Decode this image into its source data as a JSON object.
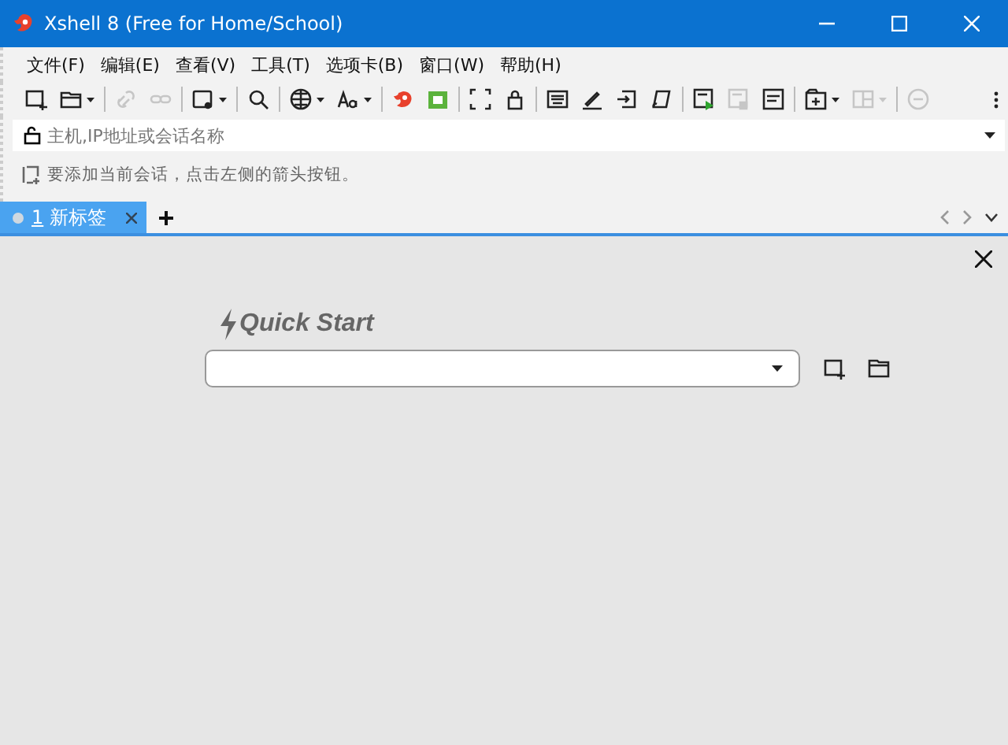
{
  "window": {
    "title": "Xshell 8 (Free for Home/School)"
  },
  "menu": [
    "文件(F)",
    "编辑(E)",
    "查看(V)",
    "工具(T)",
    "选项卡(B)",
    "窗口(W)",
    "帮助(H)"
  ],
  "toolbar": [
    {
      "kind": "button",
      "disabled": false,
      "dropdown": false
    },
    {
      "kind": "button",
      "disabled": false,
      "dropdown": true
    },
    {
      "kind": "separator"
    },
    {
      "kind": "button",
      "disabled": true,
      "dropdown": false
    },
    {
      "kind": "button",
      "disabled": true,
      "dropdown": false
    },
    {
      "kind": "separator"
    },
    {
      "kind": "button",
      "disabled": false,
      "dropdown": true
    },
    {
      "kind": "separator"
    },
    {
      "kind": "button",
      "disabled": false,
      "dropdown": false
    },
    {
      "kind": "separator"
    },
    {
      "kind": "button",
      "disabled": false,
      "dropdown": true
    },
    {
      "kind": "button",
      "disabled": false,
      "dropdown": true
    },
    {
      "kind": "separator"
    },
    {
      "kind": "button",
      "disabled": false,
      "dropdown": false
    },
    {
      "kind": "button",
      "disabled": false,
      "dropdown": false
    },
    {
      "kind": "separator"
    },
    {
      "kind": "button",
      "disabled": false,
      "dropdown": false
    },
    {
      "kind": "button",
      "disabled": false,
      "dropdown": false
    },
    {
      "kind": "separator"
    },
    {
      "kind": "button",
      "disabled": false,
      "dropdown": false
    },
    {
      "kind": "button",
      "disabled": false,
      "dropdown": false
    },
    {
      "kind": "button",
      "disabled": false,
      "dropdown": false
    },
    {
      "kind": "button",
      "disabled": false,
      "dropdown": false
    },
    {
      "kind": "separator"
    },
    {
      "kind": "button",
      "disabled": false,
      "dropdown": false
    },
    {
      "kind": "button",
      "disabled": true,
      "dropdown": false
    },
    {
      "kind": "button",
      "disabled": false,
      "dropdown": false
    },
    {
      "kind": "separator"
    },
    {
      "kind": "button",
      "disabled": false,
      "dropdown": true
    },
    {
      "kind": "button",
      "disabled": true,
      "dropdown": true
    },
    {
      "kind": "separator"
    },
    {
      "kind": "button",
      "disabled": true,
      "dropdown": false
    }
  ],
  "address_bar": {
    "placeholder": "主机,IP地址或会话名称"
  },
  "hint": "要添加当前会话，点击左侧的箭头按钮。",
  "tabs": [
    {
      "number": "1",
      "label": "新标签",
      "selected": true
    }
  ],
  "quick_start": {
    "title": "Quick Start"
  }
}
